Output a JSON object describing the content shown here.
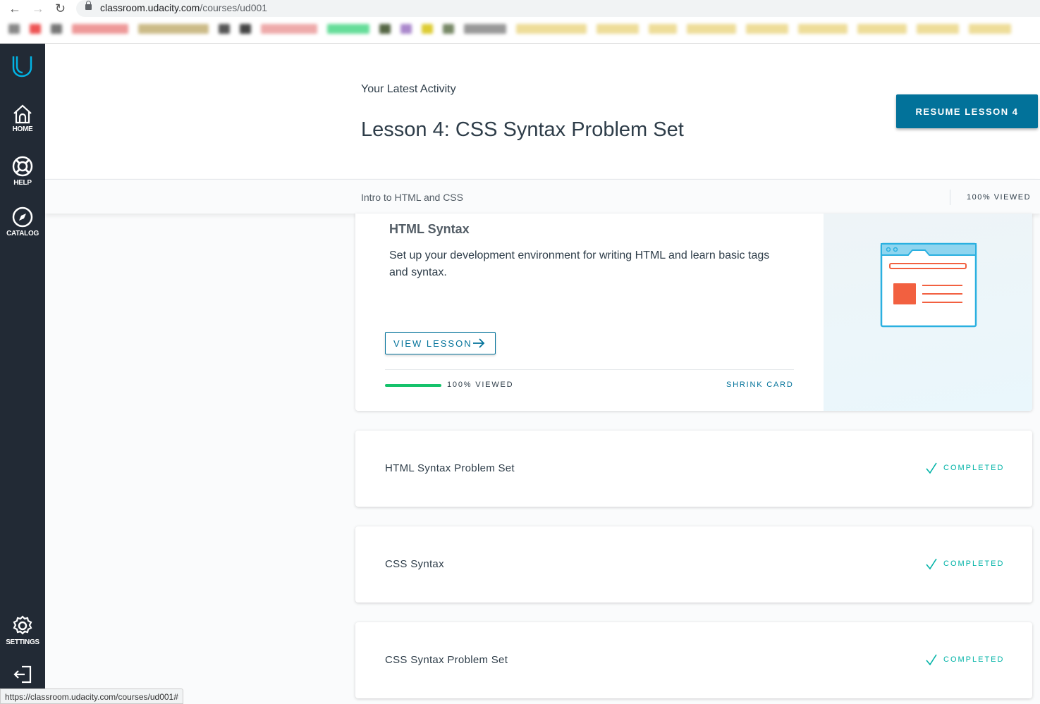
{
  "browser": {
    "url_host": "classroom.udacity.com",
    "url_path": "/courses/ud001",
    "status_url": "https://classroom.udacity.com/courses/ud001#"
  },
  "sidebar": {
    "items": [
      {
        "label": "HOME",
        "icon": "home-icon"
      },
      {
        "label": "HELP",
        "icon": "lifebuoy-icon"
      },
      {
        "label": "CATALOG",
        "icon": "compass-icon"
      },
      {
        "label": "SETTINGS",
        "icon": "gear-icon"
      }
    ]
  },
  "header": {
    "latest": "Your Latest Activity",
    "lesson_title": "Lesson 4: CSS Syntax Problem Set",
    "resume": "RESUME LESSON 4"
  },
  "subbar": {
    "course": "Intro to HTML and CSS",
    "viewed": "100% VIEWED"
  },
  "expanded": {
    "title": "HTML Syntax",
    "description": "Set up your development environment for writing HTML and learn basic tags and syntax.",
    "view_button": "VIEW LESSON",
    "progress_percent": 100,
    "progress_text": "100% VIEWED",
    "shrink": "SHRINK CARD"
  },
  "lessons": [
    {
      "title": "HTML Syntax Problem Set",
      "status": "COMPLETED"
    },
    {
      "title": "CSS Syntax",
      "status": "COMPLETED"
    },
    {
      "title": "CSS Syntax Problem Set",
      "status": "COMPLETED"
    }
  ],
  "colors": {
    "brand": "#02b3e4",
    "sidebar": "#222a35",
    "button": "#02729a",
    "progress": "#15c26b",
    "completed": "#02b3a7"
  }
}
